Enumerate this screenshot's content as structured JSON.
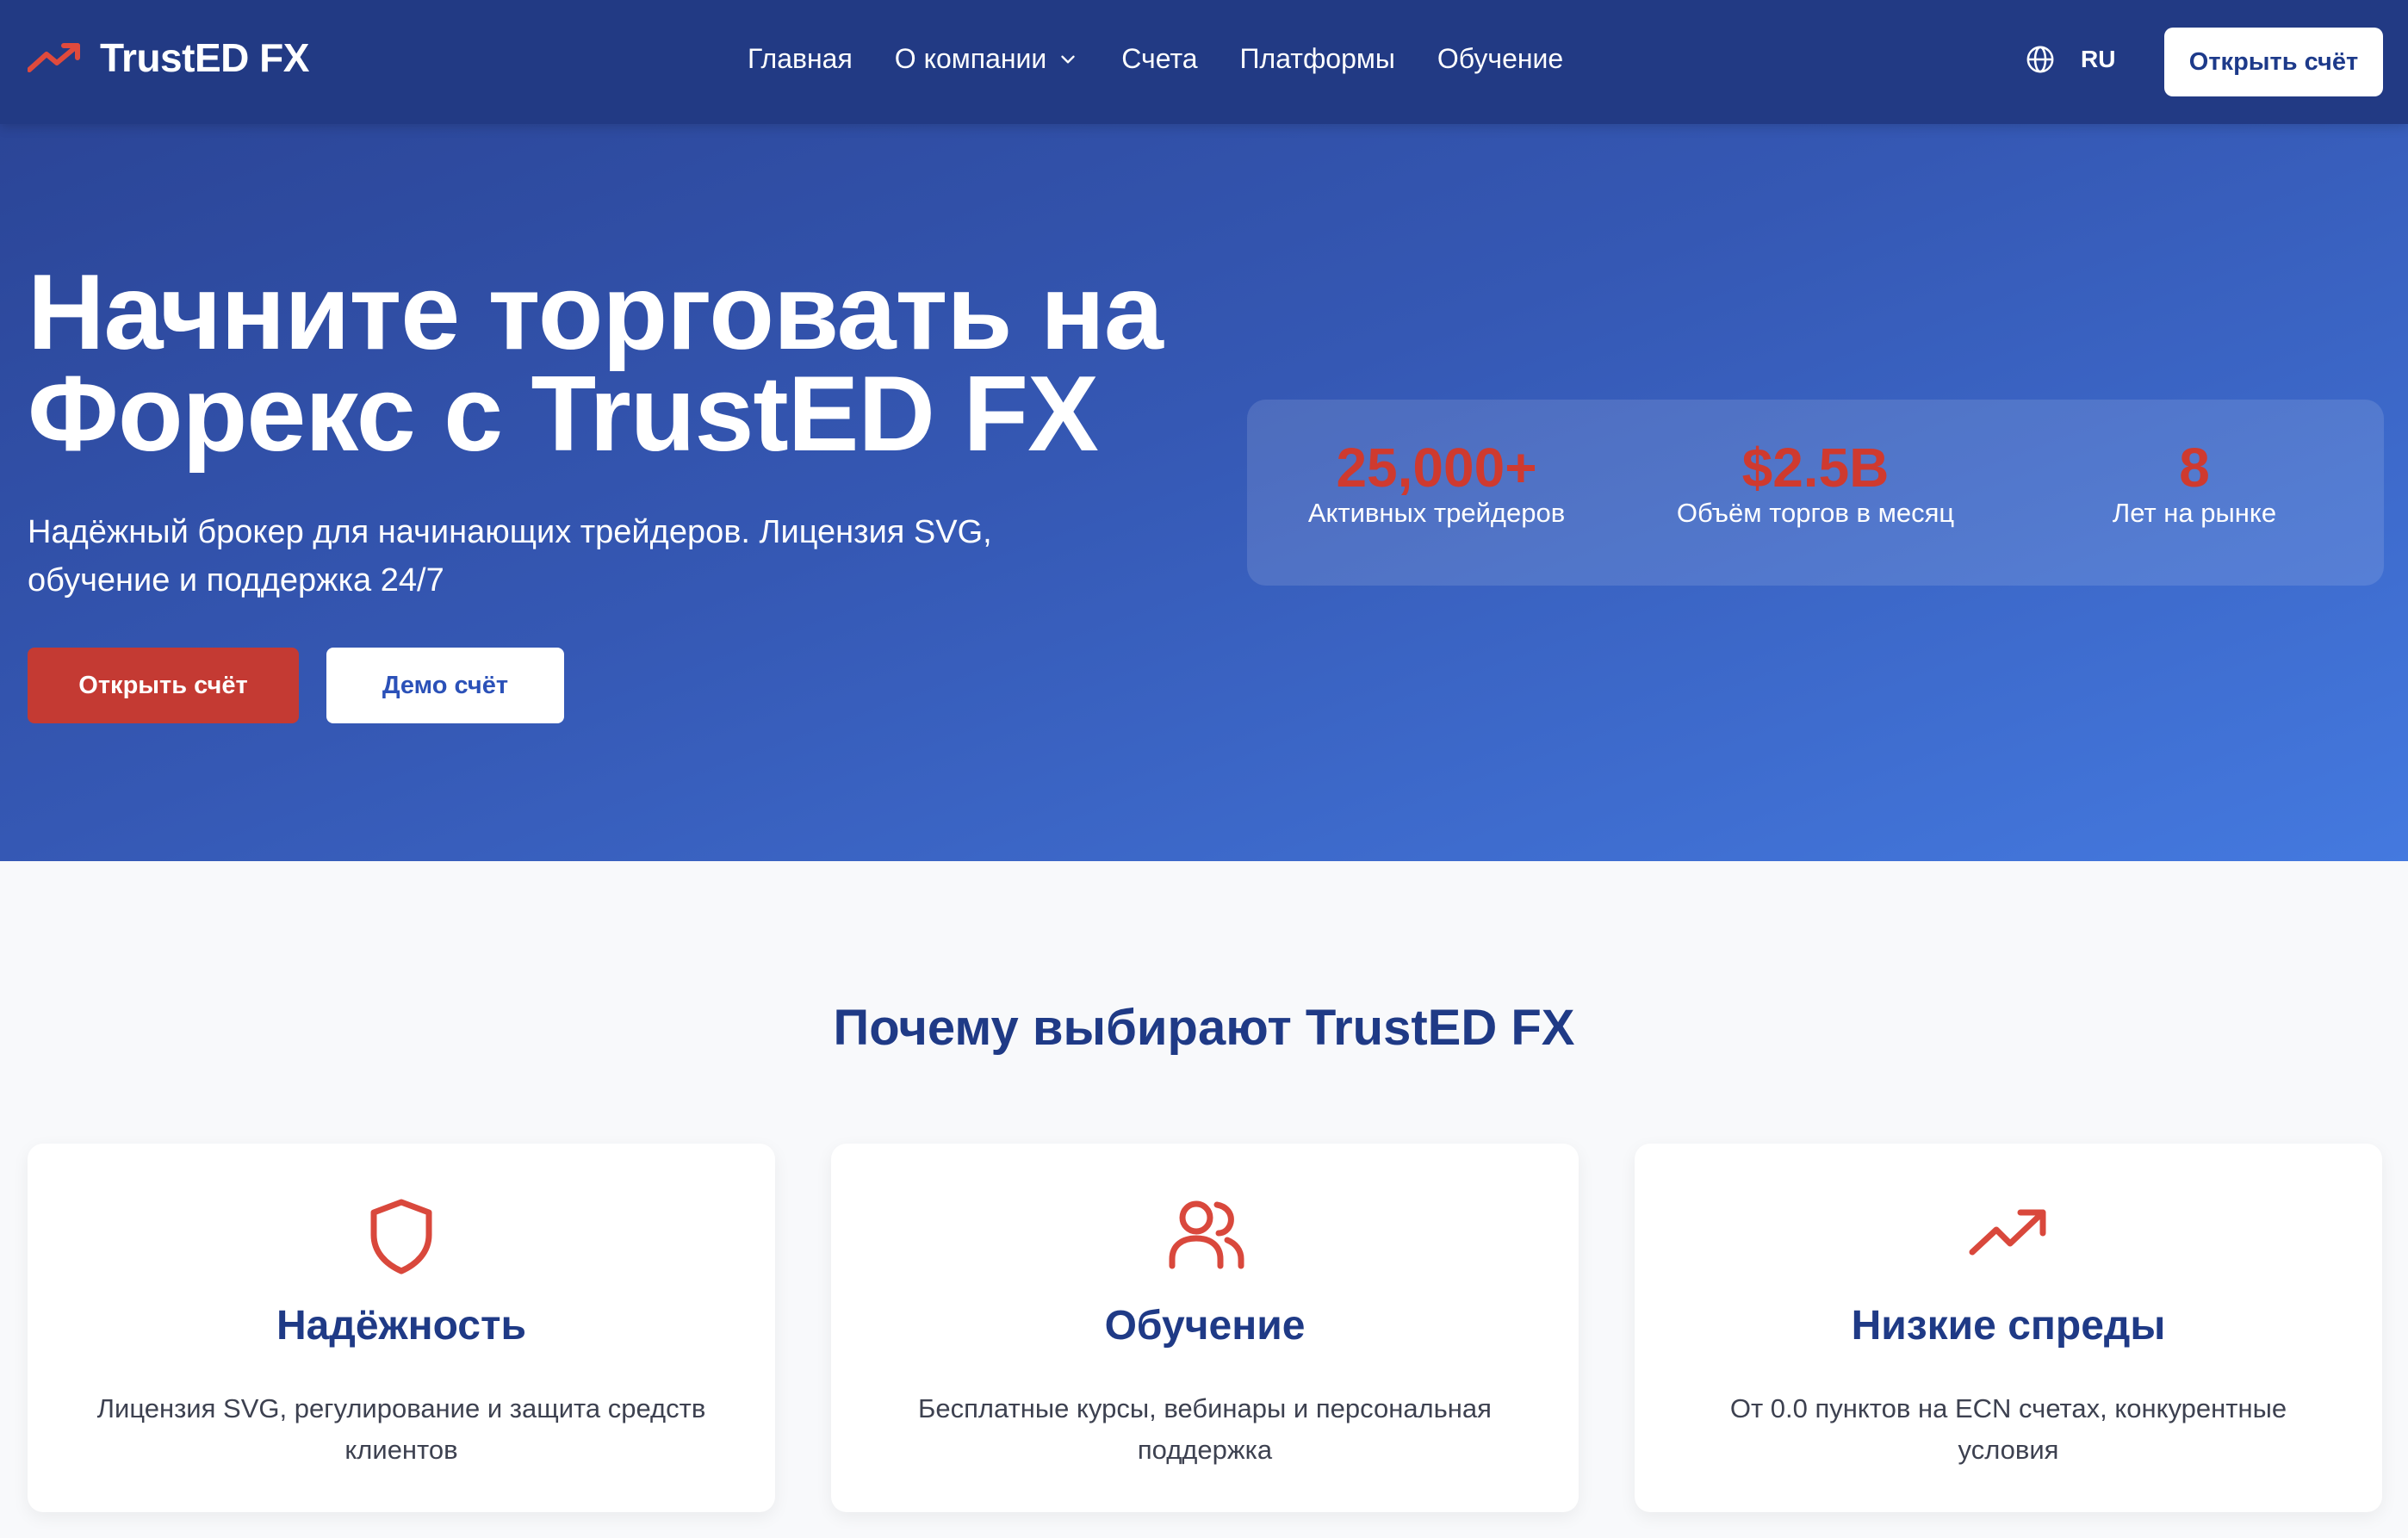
{
  "header": {
    "logo_text": "TrustED FX",
    "nav": [
      {
        "label": "Главная"
      },
      {
        "label": "О компании"
      },
      {
        "label": "Счета"
      },
      {
        "label": "Платформы"
      },
      {
        "label": "Обучение"
      }
    ],
    "lang": "RU",
    "cta": "Открыть счёт"
  },
  "hero": {
    "title_line1": "Начните торговать на",
    "title_line2": "Форекс с TrustED FX",
    "subtitle_line1": "Надёжный брокер для начинающих трейдеров. Лицензия SVG,",
    "subtitle_line2": "обучение и поддержка 24/7",
    "primary_button": "Открыть счёт",
    "secondary_button": "Демо счёт",
    "stats": [
      {
        "value": "25,000+",
        "label": "Активных трейдеров"
      },
      {
        "value": "$2.5B",
        "label": "Объём торгов в месяц"
      },
      {
        "value": "8",
        "label": "Лет на рынке"
      }
    ]
  },
  "features": {
    "title": "Почему выбирают TrustED FX",
    "cards": [
      {
        "icon": "shield-icon",
        "title": "Надёжность",
        "text_line1": "Лицензия SVG, регулирование и защита средств",
        "text_line2": "клиентов"
      },
      {
        "icon": "users-icon",
        "title": "Обучение",
        "text_line1": "Бесплатные курсы, вебинары и персональная",
        "text_line2": "поддержка"
      },
      {
        "icon": "trending-up-icon",
        "title": "Низкие спреды",
        "text_line1": "От 0.0 пунктов на ECN счетах, конкурентные",
        "text_line2": "условия"
      }
    ]
  },
  "colors": {
    "header_bg": "#223a84",
    "accent_red": "#c43a33",
    "heading_blue": "#1f3a86"
  }
}
